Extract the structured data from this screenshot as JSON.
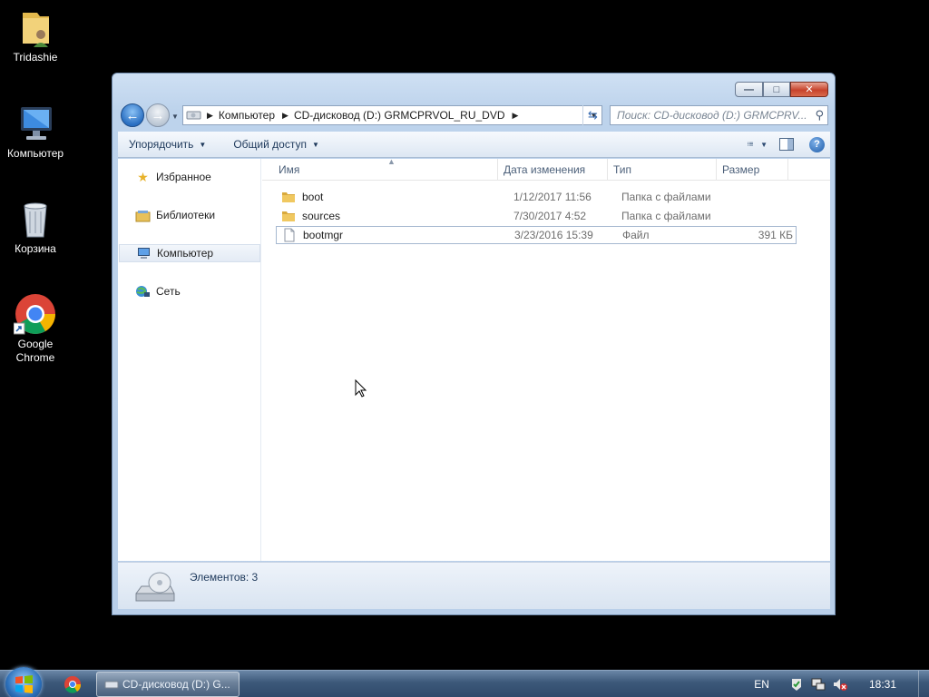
{
  "desktop": {
    "icons": [
      {
        "label": "Tridashie"
      },
      {
        "label": "Компьютер"
      },
      {
        "label": "Корзина"
      },
      {
        "label": "Google Chrome"
      }
    ]
  },
  "window": {
    "caption_buttons": {
      "minimize": "—",
      "maximize": "□",
      "close": "✕"
    },
    "nav": {
      "back": "←",
      "forward": "→"
    },
    "address": {
      "crumbs": [
        "Компьютер",
        "CD-дисковод (D:) GRMCPRVOL_RU_DVD"
      ]
    },
    "search": {
      "placeholder": "Поиск: CD-дисковод (D:) GRMCPRV..."
    },
    "commandbar": {
      "organize": "Упорядочить",
      "share": "Общий доступ"
    },
    "navpane": {
      "items": [
        {
          "label": "Избранное",
          "icon": "star-icon"
        },
        {
          "label": "Библиотеки",
          "icon": "libraries-icon"
        },
        {
          "label": "Компьютер",
          "icon": "computer-icon"
        },
        {
          "label": "Сеть",
          "icon": "network-icon"
        }
      ]
    },
    "columns": {
      "name": "Имя",
      "date": "Дата изменения",
      "type": "Тип",
      "size": "Размер"
    },
    "files": [
      {
        "name": "boot",
        "date": "1/12/2017 11:56",
        "type": "Папка с файлами",
        "size": "",
        "icon": "folder-icon"
      },
      {
        "name": "sources",
        "date": "7/30/2017 4:52",
        "type": "Папка с файлами",
        "size": "",
        "icon": "folder-icon"
      },
      {
        "name": "bootmgr",
        "date": "3/23/2016 15:39",
        "type": "Файл",
        "size": "391 КБ",
        "icon": "file-icon"
      }
    ],
    "details": {
      "count": "Элементов: 3"
    }
  },
  "taskbar": {
    "task_label": "CD-дисковод (D:) G...",
    "lang": "EN",
    "clock": "18:31"
  },
  "colors": {
    "accent": "#2a6fc2",
    "window_frame": "#bdd3ec",
    "folder": "#e8c15a",
    "close": "#c7432c"
  }
}
